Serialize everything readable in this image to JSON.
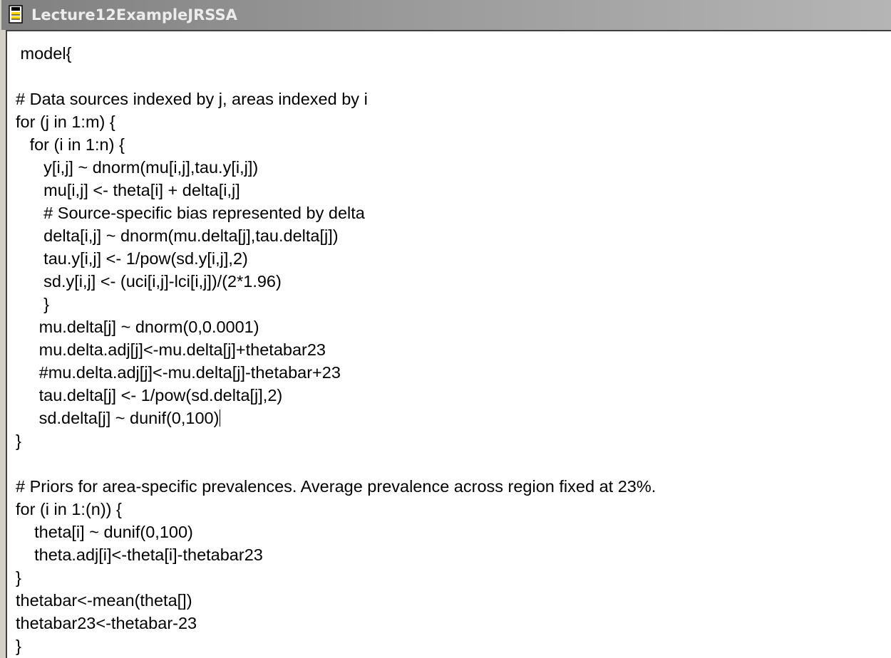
{
  "window": {
    "title": "Lecture12ExampleJRSSA",
    "icon": "document-icon"
  },
  "editor": {
    "lines": [
      " model{",
      "",
      "# Data sources indexed by j, areas indexed by i",
      "for (j in 1:m) {",
      "   for (i in 1:n) {",
      "      y[i,j] ~ dnorm(mu[i,j],tau.y[i,j])",
      "      mu[i,j] <- theta[i] + delta[i,j]",
      "      # Source-specific bias represented by delta",
      "      delta[i,j] ~ dnorm(mu.delta[j],tau.delta[j])",
      "      tau.y[i,j] <- 1/pow(sd.y[i,j],2)",
      "      sd.y[i,j] <- (uci[i,j]-lci[i,j])/(2*1.96)",
      "      }",
      "     mu.delta[j] ~ dnorm(0,0.0001)",
      "     mu.delta.adj[j]<-mu.delta[j]+thetabar23",
      "     #mu.delta.adj[j]<-mu.delta[j]-thetabar+23",
      "     tau.delta[j] <- 1/pow(sd.delta[j],2)",
      "     sd.delta[j] ~ dunif(0,100)",
      "}",
      "",
      "# Priors for area-specific prevalences. Average prevalence across region fixed at 23%.",
      "for (i in 1:(n)) {",
      "    theta[i] ~ dunif(0,100)",
      "    theta.adj[i]<-theta[i]-thetabar23",
      "}",
      "thetabar<-mean(theta[])",
      "thetabar23<-thetabar-23",
      "}"
    ]
  }
}
